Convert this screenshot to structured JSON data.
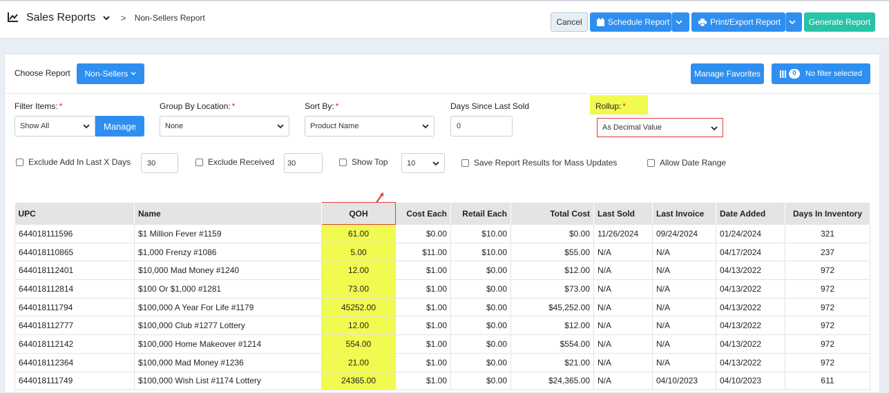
{
  "header": {
    "title": "Sales Reports",
    "breadcrumb_sep": ">",
    "subtitle": "Non-Sellers Report",
    "cancel_label": "Cancel",
    "schedule_label": "Schedule Report",
    "print_label": "Print/Export Report",
    "generate_label": "Generate Report"
  },
  "controls": {
    "choose_report_label": "Choose Report",
    "report_value": "Non-Sellers",
    "manage_favorites_label": "Manage Favorites",
    "filter_count": "0",
    "filter_label": "No filter selected"
  },
  "filters": {
    "filter_items_label": "Filter Items:",
    "filter_items_value": "Show All",
    "manage_label": "Manage",
    "group_by_label": "Group By Location:",
    "group_by_value": "None",
    "sort_by_label": "Sort By:",
    "sort_by_value": "Product Name",
    "days_since_label": "Days Since Last Sold",
    "days_since_value": "0",
    "rollup_label": "Rollup:",
    "rollup_value": "As Decimal Value",
    "required_mark": "*"
  },
  "options": {
    "exclude_add_label": "Exclude Add In Last X Days",
    "exclude_add_value": "30",
    "exclude_received_label": "Exclude Received",
    "exclude_received_value": "30",
    "show_top_label": "Show Top",
    "show_top_value": "10",
    "save_results_label": "Save Report Results for Mass Updates",
    "allow_date_label": "Allow Date Range"
  },
  "table": {
    "headers": [
      "UPC",
      "Name",
      "QOH",
      "Cost Each",
      "Retail Each",
      "Total Cost",
      "Last Sold",
      "Last Invoice",
      "Date Added",
      "Days In Inventory"
    ],
    "rows": [
      [
        "644018111596",
        "$1 Million Fever #1159",
        "61.00",
        "$0.00",
        "$10.00",
        "$0.00",
        "11/26/2024",
        "09/24/2024",
        "01/24/2024",
        "321"
      ],
      [
        "644018110865",
        "$1,000 Frenzy #1086",
        "5.00",
        "$11.00",
        "$10.00",
        "$55.00",
        "N/A",
        "N/A",
        "04/17/2024",
        "237"
      ],
      [
        "644018112401",
        "$10,000 Mad Money #1240",
        "12.00",
        "$1.00",
        "$0.00",
        "$12.00",
        "N/A",
        "N/A",
        "04/13/2022",
        "972"
      ],
      [
        "644018112814",
        "$100 Or $1,000 #1281",
        "73.00",
        "$1.00",
        "$0.00",
        "$73.00",
        "N/A",
        "N/A",
        "04/13/2022",
        "972"
      ],
      [
        "644018111794",
        "$100,000 A Year For Life #1179",
        "45252.00",
        "$1.00",
        "$0.00",
        "$45,252.00",
        "N/A",
        "N/A",
        "04/13/2022",
        "972"
      ],
      [
        "644018112777",
        "$100,000 Club #1277 Lottery",
        "12.00",
        "$1.00",
        "$0.00",
        "$12.00",
        "N/A",
        "N/A",
        "04/13/2022",
        "972"
      ],
      [
        "644018112142",
        "$100,000 Home Makeover #1214",
        "554.00",
        "$1.00",
        "$0.00",
        "$554.00",
        "N/A",
        "N/A",
        "04/13/2022",
        "972"
      ],
      [
        "644018112364",
        "$100,000 Mad Money #1236",
        "21.00",
        "$1.00",
        "$0.00",
        "$21.00",
        "N/A",
        "N/A",
        "04/13/2022",
        "972"
      ],
      [
        "644018111749",
        "$100,000 Wish List #1174 Lottery",
        "24365.00",
        "$1.00",
        "$0.00",
        "$24,365.00",
        "N/A",
        "04/10/2023",
        "04/10/2023",
        "611"
      ]
    ]
  },
  "colors": {
    "primary": "#2f8ff0",
    "generate": "#27c3a5",
    "highlight": "#f0fa4f",
    "annotation": "#e03a3a"
  }
}
